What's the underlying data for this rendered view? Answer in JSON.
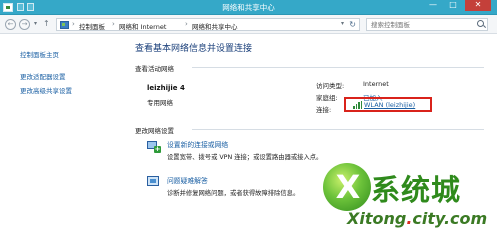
{
  "window": {
    "title": "网络和共享中心",
    "controls": {
      "minimize": "—",
      "maximize": "□",
      "close": "✕"
    }
  },
  "address_bar": {
    "nav": {
      "back": "←",
      "forward": "→",
      "dropdown": "▾",
      "up": "↑"
    },
    "breadcrumbs": [
      "控制面板",
      "网络和 Internet",
      "网络和共享中心"
    ],
    "separator": "›",
    "end_dropdown": "▾",
    "refresh": "↻",
    "search_placeholder": "搜索控制面板"
  },
  "sidebar": {
    "items": [
      {
        "label": "控制面板主页"
      },
      {
        "label": "更改适配器设置"
      },
      {
        "label": "更改高级共享设置"
      }
    ]
  },
  "main": {
    "heading": "查看基本网络信息并设置连接",
    "active_networks_label": "查看活动网络",
    "network": {
      "name": "leizhijie  4",
      "type": "专用网络",
      "access_type_label": "访问类型:",
      "access_type_value": "Internet",
      "homegroup_label": "家庭组:",
      "homegroup_value": "已加入",
      "connections_label": "连接:",
      "connection_value": "WLAN (leizhijie)"
    },
    "change_settings_label": "更改网络设置",
    "tasks": [
      {
        "title": "设置新的连接或网络",
        "description": "设置宽带、拨号或 VPN 连接；或设置路由器或接入点。"
      },
      {
        "title": "问题疑难解答",
        "description": "诊断并修复网络问题，或者获得故障排除信息。"
      }
    ]
  },
  "watermark": {
    "brand_cn": "系统城",
    "brand_dot": "·",
    "url_prefix": "Xitong",
    "url_dot": ".",
    "url_suffix": "city.com",
    "orb_letter": "X",
    "colors": {
      "green": "#2f8a1c",
      "red": "#d92b1f"
    }
  },
  "colors": {
    "titlebar": "#35a8c8",
    "link": "#1a5fa3",
    "heading": "#1a3f7a",
    "highlight_box": "#d9231b"
  }
}
